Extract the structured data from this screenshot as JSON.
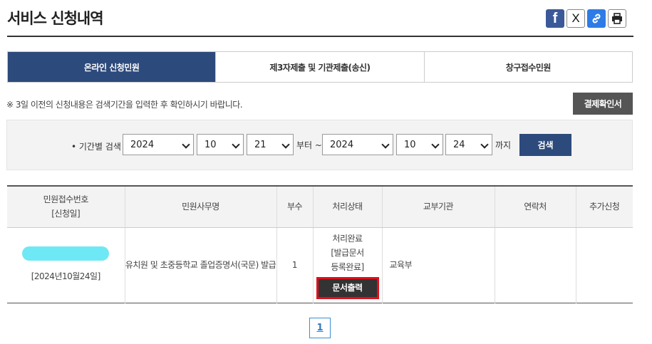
{
  "page": {
    "title": "서비스 신청내역"
  },
  "share": {
    "facebook": "f",
    "twitter": "X"
  },
  "tabs": [
    {
      "label": "온라인 신청민원",
      "active": true
    },
    {
      "label": "제3자제출 및 기관제출(송신)",
      "active": false
    },
    {
      "label": "창구접수민원",
      "active": false
    }
  ],
  "notice": "※ 3일 이전의 신청내용은 검색기간을 입력한 후 확인하시기 바랍니다.",
  "confirm_button": "결제확인서",
  "search": {
    "label": "• 기간별 검색",
    "start_year": "2024",
    "start_month": "10",
    "start_day": "21",
    "from_text": "부터 ~",
    "end_year": "2024",
    "end_month": "10",
    "end_day": "24",
    "to_text": "까지",
    "button": "검색"
  },
  "table": {
    "headers": {
      "receipt_line1": "민원접수번호",
      "receipt_line2": "[신청일]",
      "name": "민원사무명",
      "copies": "부수",
      "status": "처리상태",
      "agency": "교부기관",
      "contact": "연락처",
      "extra": "추가신청"
    },
    "rows": [
      {
        "date": "[2024년10월24일]",
        "name": "유치원 및 초중등학교 졸업증명서(국문) 발급",
        "copies": "1",
        "status_line1": "처리완료",
        "status_line2": "[발급문서",
        "status_line3": "등록완료]",
        "print_button": "문서출력",
        "agency": "교육부",
        "contact": "",
        "extra": ""
      }
    ]
  },
  "pagination": {
    "current": "1"
  },
  "colors": {
    "accent": "#2d4a7c",
    "highlight": "#e0101b"
  }
}
